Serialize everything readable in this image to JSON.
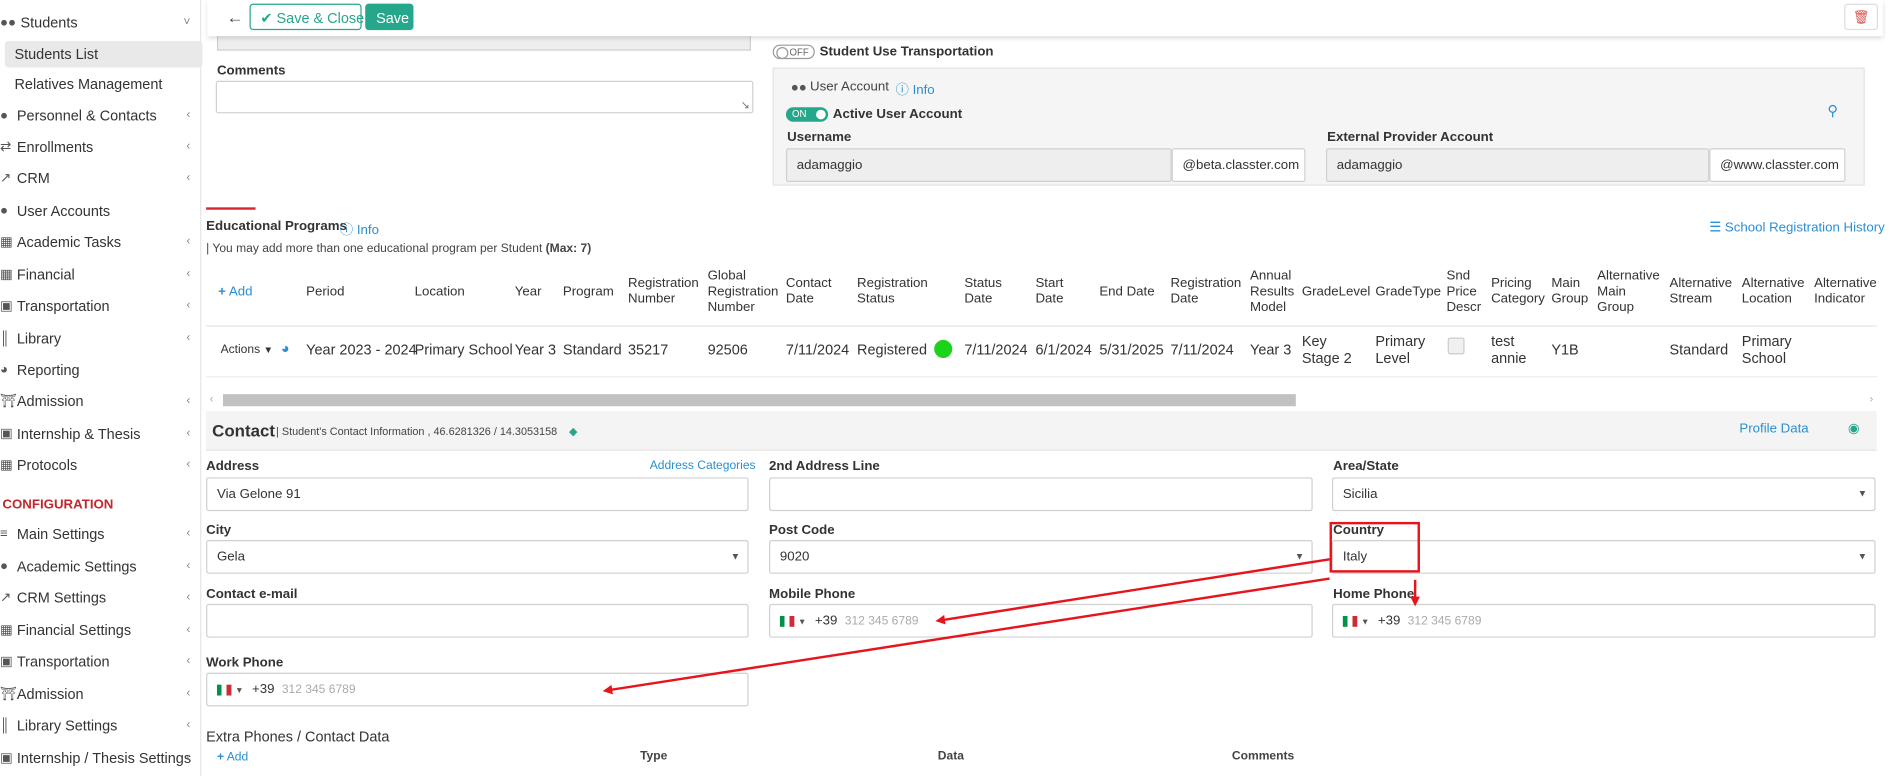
{
  "sidebar": {
    "items": [
      {
        "label": "Students",
        "icon": "users-icon",
        "chevron": "˅"
      },
      {
        "label": "Students List"
      },
      {
        "label": "Relatives Management"
      },
      {
        "label": "Personnel & Contacts",
        "icon": "people-icon",
        "chevron": "‹"
      },
      {
        "label": "Enrollments",
        "icon": "swap-icon",
        "chevron": "‹"
      },
      {
        "label": "CRM",
        "icon": "share-icon",
        "chevron": "‹"
      },
      {
        "label": "User Accounts",
        "icon": "user-circle-icon"
      },
      {
        "label": "Academic Tasks",
        "icon": "tasks-icon",
        "chevron": "‹"
      },
      {
        "label": "Financial",
        "icon": "calculator-icon",
        "chevron": "‹"
      },
      {
        "label": "Transportation",
        "icon": "bus-icon",
        "chevron": "‹"
      },
      {
        "label": "Library",
        "icon": "books-icon",
        "chevron": "‹"
      },
      {
        "label": "Reporting",
        "icon": "chart-icon"
      },
      {
        "label": "Admission",
        "icon": "building-icon",
        "chevron": "‹"
      },
      {
        "label": "Internship & Thesis",
        "icon": "briefcase-icon",
        "chevron": "‹"
      },
      {
        "label": "Protocols",
        "icon": "archive-icon",
        "chevron": "‹"
      }
    ],
    "config_heading": "CONFIGURATION",
    "config_items": [
      {
        "label": "Main Settings",
        "icon": "menu-icon",
        "chevron": "‹"
      },
      {
        "label": "Academic Settings",
        "icon": "grad-icon",
        "chevron": "‹"
      },
      {
        "label": "CRM Settings",
        "icon": "share-icon",
        "chevron": "‹"
      },
      {
        "label": "Financial Settings",
        "icon": "money-icon",
        "chevron": "‹"
      },
      {
        "label": "Transportation",
        "icon": "bus-icon",
        "chevron": "‹"
      },
      {
        "label": "Admission",
        "icon": "building-icon",
        "chevron": "‹"
      },
      {
        "label": "Library Settings",
        "icon": "books-icon",
        "chevron": "‹"
      },
      {
        "label": "Internship / Thesis Settings",
        "icon": "briefcase-icon",
        "chevron": "‹"
      }
    ]
  },
  "toolbar": {
    "back_icon": "←",
    "save_close_label": "Save & Close",
    "save_label": "Save",
    "delete_icon": "🗑"
  },
  "comments": {
    "label": "Comments"
  },
  "transport": {
    "toggle": "OFF",
    "label": "Student Use Transportation"
  },
  "user_account": {
    "title": "User Account",
    "info": "Info",
    "toggle": "ON",
    "active_label": "Active User Account",
    "username_label": "Username",
    "username": "adamaggio",
    "username_domain": "@beta.classter.com",
    "external_label": "External Provider Account",
    "external": "adamaggio",
    "external_domain": "@www.classter.com"
  },
  "programs": {
    "title": "Educational Programs",
    "info": "Info",
    "note_prefix": "| You may add more than one educational program per Student ",
    "note_max": "(Max: 7)",
    "history": "School Registration History",
    "add": "Add",
    "headers": [
      "Period",
      "Location",
      "Year",
      "Program",
      "Registration Number",
      "Global Registration Number",
      "Contact Date",
      "Registration Status",
      "Status Date",
      "Start Date",
      "End Date",
      "Registration Date",
      "Annual Results Model",
      "GradeLevel",
      "GradeType",
      "Snd Price Descr",
      "Pricing Category",
      "Main Group",
      "Alternative Main Group",
      "Alternative Stream",
      "Alternative Location",
      "Alternative Indicator"
    ],
    "row": {
      "actions": "Actions",
      "period": "Year 2023 - 2024",
      "location": "Primary School",
      "year": "Year 3",
      "program": "Standard",
      "reg_number": "35217",
      "global_reg_number": "92506",
      "contact_date": "7/11/2024",
      "reg_status": "Registered",
      "status_date": "7/11/2024",
      "start_date": "6/1/2024",
      "end_date": "5/31/2025",
      "reg_date": "7/11/2024",
      "results_model": "Year 3",
      "grade_level": "Key Stage 2",
      "grade_type": "Primary Level",
      "pricing_category": "test annie",
      "main_group": "Y1B",
      "alt_stream": "Standard",
      "alt_location": "Primary School"
    }
  },
  "contact": {
    "title": "Contact",
    "subtitle": "| Student's Contact Information , 46.6281326 / 14.3053158",
    "profile_data": "Profile Data",
    "address_label": "Address",
    "address_categories": "Address Categories",
    "address": "Via Gelone 91",
    "address2_label": "2nd Address Line",
    "area_label": "Area/State",
    "area": "Sicilia",
    "city_label": "City",
    "city": "Gela",
    "postcode_label": "Post Code",
    "postcode": "9020",
    "country_label": "Country",
    "country": "Italy",
    "email_label": "Contact e-mail",
    "mobile_label": "Mobile Phone",
    "home_label": "Home Phone",
    "work_label": "Work Phone",
    "dial_code": "+39",
    "phone_placeholder": "312 345 6789",
    "extra_title": "Extra Phones / Contact Data",
    "extra_add": "Add",
    "extra_headers": [
      "Type",
      "Data",
      "Comments"
    ]
  },
  "colors": {
    "accent": "#26a68b",
    "link": "#2a8fd3",
    "highlight": "#e8141b",
    "config": "#c0282d"
  }
}
